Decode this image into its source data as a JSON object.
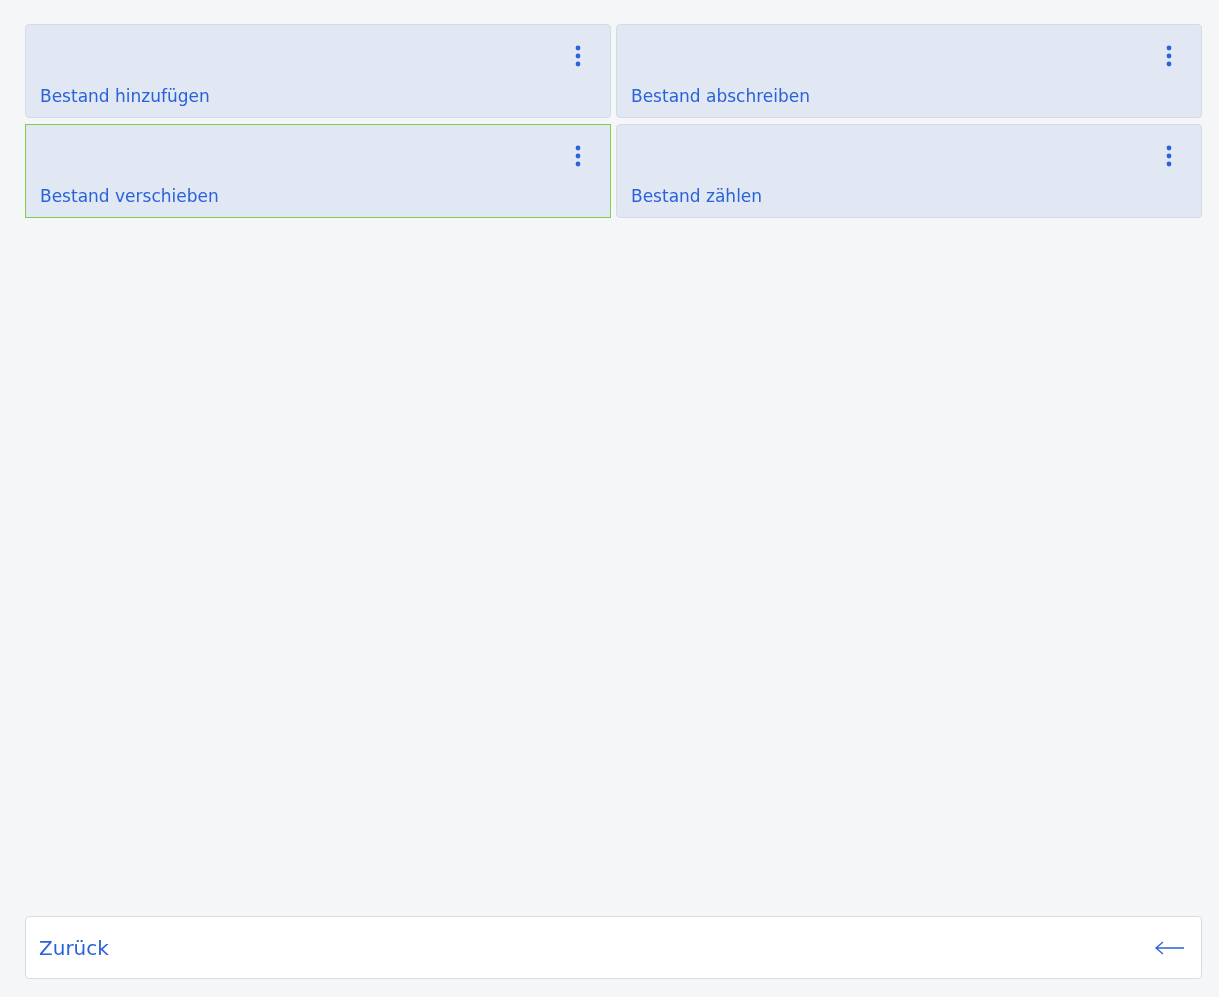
{
  "tiles": [
    {
      "label": "Bestand hinzufügen",
      "selected": false
    },
    {
      "label": "Bestand abschreiben",
      "selected": false
    },
    {
      "label": "Bestand verschieben",
      "selected": true
    },
    {
      "label": "Bestand zählen",
      "selected": false
    }
  ],
  "back_button": {
    "label": "Zurück"
  }
}
